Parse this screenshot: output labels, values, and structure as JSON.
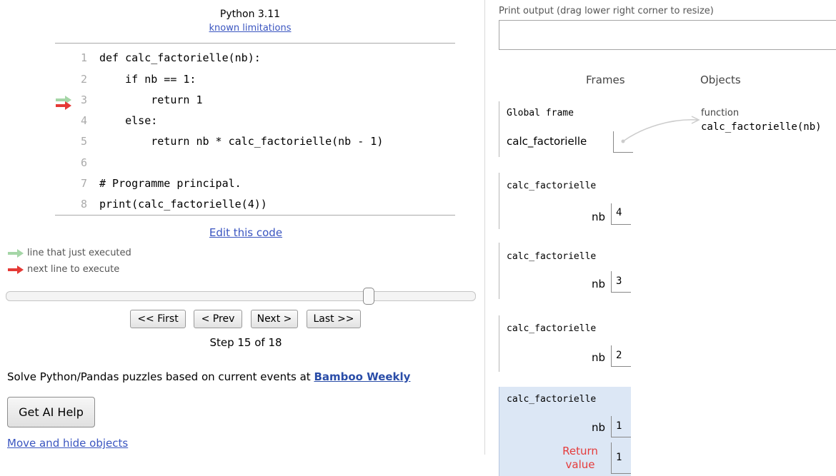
{
  "header": {
    "language": "Python 3.11",
    "limitations_link": "known limitations"
  },
  "code": {
    "lines": [
      {
        "num": "1",
        "text": "def calc_factorielle(nb):"
      },
      {
        "num": "2",
        "text": "    if nb == 1:"
      },
      {
        "num": "3",
        "text": "        return 1"
      },
      {
        "num": "4",
        "text": "    else:"
      },
      {
        "num": "5",
        "text": "        return nb * calc_factorielle(nb - 1)"
      },
      {
        "num": "6",
        "text": ""
      },
      {
        "num": "7",
        "text": "# Programme principal."
      },
      {
        "num": "8",
        "text": "print(calc_factorielle(4))"
      }
    ],
    "just_executed_line": 3,
    "next_line": 3
  },
  "edit_link": "Edit this code",
  "legend": {
    "just_executed": "line that just executed",
    "next_line": "next line to execute",
    "just_executed_color": "#a5d6a7",
    "next_line_color": "#e53935"
  },
  "navigation": {
    "first": "<< First",
    "prev": "< Prev",
    "next": "Next >",
    "last": "Last >>",
    "step_label": "Step 15 of 18",
    "current_step": 15,
    "total_steps": 18
  },
  "promo": {
    "text": "Solve Python/Pandas puzzles based on current events at ",
    "link": "Bamboo Weekly"
  },
  "ai_help_button": "Get AI Help",
  "move_hide_link": "Move and hide objects",
  "print_output": {
    "label": "Print output (drag lower right corner to resize)",
    "value": ""
  },
  "columns": {
    "frames": "Frames",
    "objects": "Objects"
  },
  "global_frame": {
    "title": "Global frame",
    "var": "calc_factorielle"
  },
  "frames": [
    {
      "name": "calc_factorielle",
      "var": "nb",
      "value": "4"
    },
    {
      "name": "calc_factorielle",
      "var": "nb",
      "value": "3"
    },
    {
      "name": "calc_factorielle",
      "var": "nb",
      "value": "2"
    },
    {
      "name": "calc_factorielle",
      "var": "nb",
      "value": "1",
      "return_label_1": "Return",
      "return_label_2": "value",
      "return_value": "1"
    }
  ],
  "object": {
    "type": "function",
    "value": "calc_factorielle(nb)"
  },
  "colors": {
    "active_frame": "#dce7f5",
    "return_label": "#e53b3b",
    "link": "#3a55c0"
  }
}
